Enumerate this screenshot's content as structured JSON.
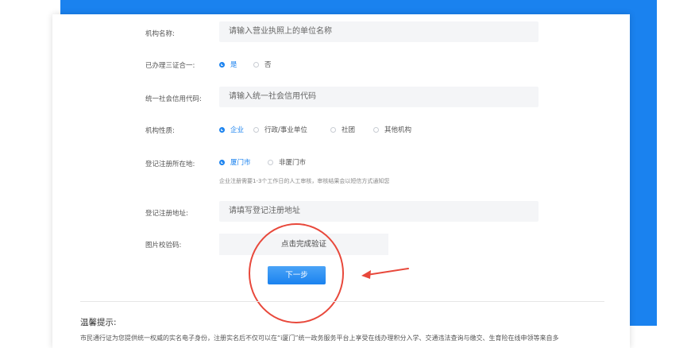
{
  "form": {
    "org_name": {
      "label": "机构名称:",
      "placeholder": "请输入营业执照上的单位名称"
    },
    "three_in_one": {
      "label": "已办理三证合一:",
      "options": [
        "是",
        "否"
      ],
      "selected": "是"
    },
    "credit_code": {
      "label": "统一社会信用代码:",
      "placeholder": "请输入统一社会信用代码"
    },
    "org_type": {
      "label": "机构性质:",
      "options": [
        "企业",
        "行政/事业单位",
        "社团",
        "其他机构"
      ],
      "selected": "企业"
    },
    "reg_location": {
      "label": "登记注册所在地:",
      "options": [
        "厦门市",
        "非厦门市"
      ],
      "selected": "厦门市",
      "hint": "企业注册需要1-3个工作日的人工审核，审核结果会以短信方式通知您"
    },
    "reg_address": {
      "label": "登记注册地址:",
      "placeholder": "请填写登记注册地址"
    },
    "captcha": {
      "label": "图片校验码:",
      "button": "点击完成验证"
    },
    "next_button": "下一步"
  },
  "tips": {
    "title": "温馨提示:",
    "text": "市民通行证为您提供统一权威的实名电子身份，注册实名后不仅可以在“i厦门”统一政务服务平台上享受在线办理积分入学、交通违法查询与缴交、生育险在线申领等来自多"
  },
  "colors": {
    "accent": "#1a82ef",
    "annotation": "#e8483b"
  }
}
